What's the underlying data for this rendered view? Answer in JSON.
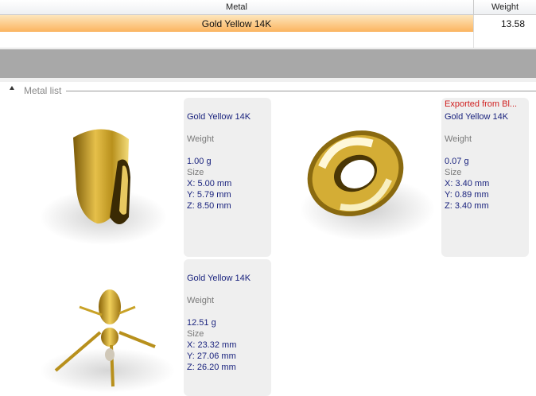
{
  "grid": {
    "columns": [
      "Metal",
      "Weight"
    ],
    "rows": [
      {
        "metal": "Gold Yellow 14K",
        "weight": "13.58"
      }
    ]
  },
  "group": {
    "label": "Metal list"
  },
  "items": [
    {
      "name": "Gold Yellow 14K",
      "weight_label": "Weight",
      "weight": "1.00 g",
      "size_label": "Size",
      "x": "X: 5.00 mm",
      "y": "Y: 5.79 mm",
      "z": "Z: 8.50 mm",
      "icon": "ring-thumbnail"
    },
    {
      "note": "Exported from Bl...",
      "name": "Gold Yellow 14K",
      "weight_label": "Weight",
      "weight": "0.07 g",
      "size_label": "Size",
      "x": "X: 3.40 mm",
      "y": "Y: 0.89 mm",
      "z": "Z: 3.40 mm",
      "icon": "torus-thumbnail"
    },
    {
      "name": "Gold Yellow 14K",
      "weight_label": "Weight",
      "weight": "12.51 g",
      "size_label": "Size",
      "x": "X: 23.32 mm",
      "y": "Y: 27.06 mm",
      "z": "Z: 26.20 mm",
      "icon": "bee-thumbnail"
    }
  ],
  "colors": {
    "selected_row": "#fbb45f",
    "info_text": "#1a237e",
    "note_text": "#d02020",
    "gold": "#c9a227"
  }
}
